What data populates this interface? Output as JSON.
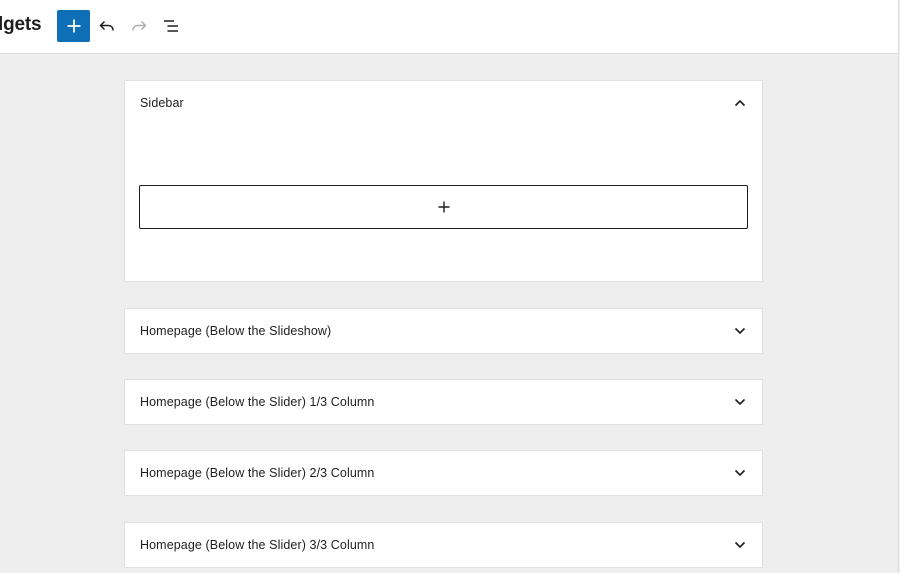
{
  "header": {
    "title": "lgets",
    "add_block": "Add block",
    "undo": "Undo",
    "redo": "Redo",
    "list_view": "List view"
  },
  "widget_areas": [
    {
      "title": "Sidebar",
      "expanded": true,
      "icon": "chevron-up-icon"
    },
    {
      "title": "Homepage (Below the Slideshow)",
      "expanded": false,
      "icon": "chevron-down-icon"
    },
    {
      "title": "Homepage (Below the Slider) 1/3 Column",
      "expanded": false,
      "icon": "chevron-down-icon"
    },
    {
      "title": "Homepage (Below the Slider) 2/3 Column",
      "expanded": false,
      "icon": "chevron-down-icon"
    },
    {
      "title": "Homepage (Below the Slider) 3/3 Column",
      "expanded": false,
      "icon": "chevron-down-icon"
    }
  ],
  "colors": {
    "accent": "#0e6eb6",
    "background": "#eeeeee",
    "panel": "#ffffff",
    "text": "#1e1e1e"
  }
}
